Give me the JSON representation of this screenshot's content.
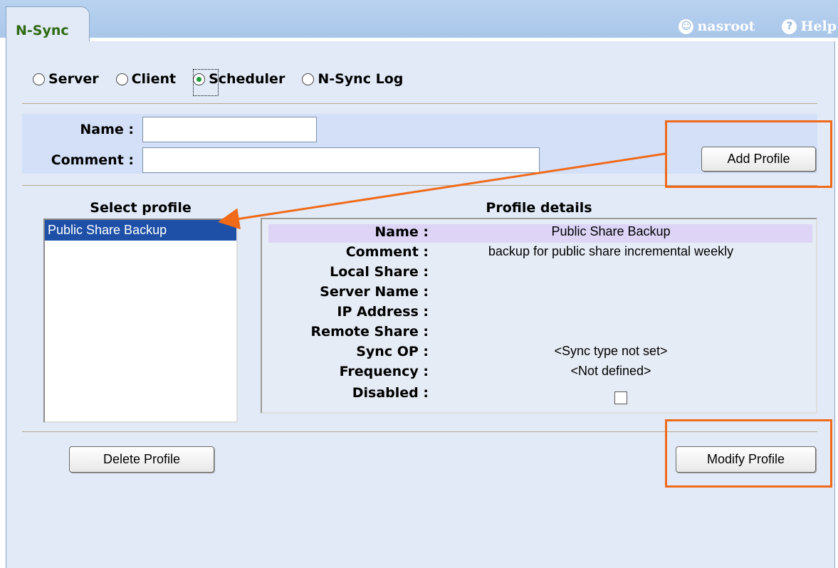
{
  "tab": {
    "label": "N-Sync"
  },
  "top_links": {
    "user": "nasroot",
    "help": "Help"
  },
  "modes": [
    {
      "label": "Server",
      "selected": false
    },
    {
      "label": "Client",
      "selected": false
    },
    {
      "label": "Scheduler",
      "selected": true
    },
    {
      "label": "N-Sync Log",
      "selected": false
    }
  ],
  "form": {
    "name_label": "Name :",
    "name_value": "",
    "comment_label": "Comment :",
    "comment_value": "",
    "add_button": "Add Profile"
  },
  "select_profile": {
    "title": "Select profile",
    "items": [
      "Public Share Backup"
    ],
    "selected_index": 0
  },
  "profile_details": {
    "title": "Profile details",
    "rows": [
      {
        "key": "Name :",
        "value": "Public Share Backup"
      },
      {
        "key": "Comment :",
        "value": "backup for public share incremental weekly"
      },
      {
        "key": "Local Share :",
        "value": ""
      },
      {
        "key": "Server Name :",
        "value": ""
      },
      {
        "key": "IP Address :",
        "value": ""
      },
      {
        "key": "Remote Share :",
        "value": ""
      },
      {
        "key": "Sync OP :",
        "value": "<Sync type not set>"
      },
      {
        "key": "Frequency :",
        "value": "<Not defined>"
      },
      {
        "key": "Disabled :",
        "value": ""
      }
    ],
    "disabled_checked": false
  },
  "buttons": {
    "delete": "Delete Profile",
    "modify": "Modify Profile"
  },
  "colors": {
    "annotation": "#f06a1a",
    "selected_item": "#1e50a8",
    "tab_text": "#2e6a12"
  }
}
